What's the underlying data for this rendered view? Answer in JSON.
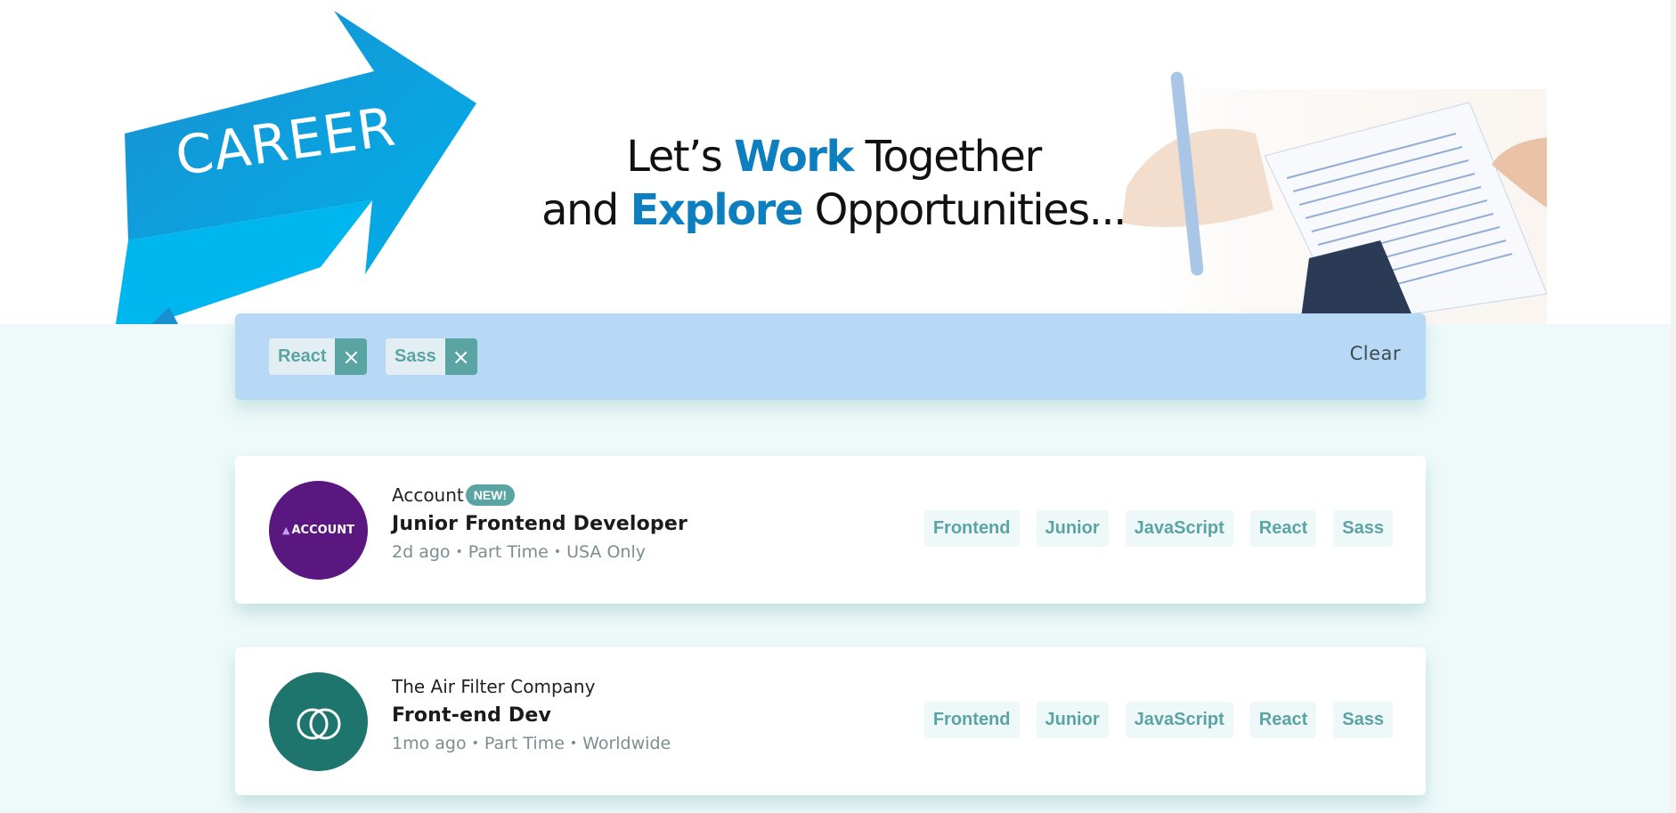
{
  "hero": {
    "career_text": "CAREER",
    "tagline": {
      "line1_pre": "Let’s ",
      "line1_accent": "Work",
      "line1_post": " Together",
      "line2_pre": "and ",
      "line2_accent": "Explore",
      "line2_post": " Opportunities..."
    }
  },
  "filters": {
    "chips": [
      "React",
      "Sass"
    ],
    "clear_label": "Clear"
  },
  "jobs": [
    {
      "logo_text": "ACCOUNT",
      "company": "Account",
      "badge": "NEW!",
      "position": "Junior Frontend Developer",
      "posted": "2d ago",
      "contract": "Part Time",
      "location": "USA Only",
      "tags": [
        "Frontend",
        "Junior",
        "JavaScript",
        "React",
        "Sass"
      ]
    },
    {
      "company": "The Air Filter Company",
      "position": "Front-end Dev",
      "posted": "1mo ago",
      "contract": "Part Time",
      "location": "Worldwide",
      "tags": [
        "Frontend",
        "Junior",
        "JavaScript",
        "React",
        "Sass"
      ]
    }
  ],
  "separator": "•",
  "remove_icon": "×",
  "colors": {
    "accent": "#5ba4a4",
    "filter_bar": "#b7d9f6",
    "background": "#eef9f9",
    "account_logo": "#5a1780",
    "air_filter_logo": "#1e756e",
    "hero_blue": "#0d7fbf"
  }
}
